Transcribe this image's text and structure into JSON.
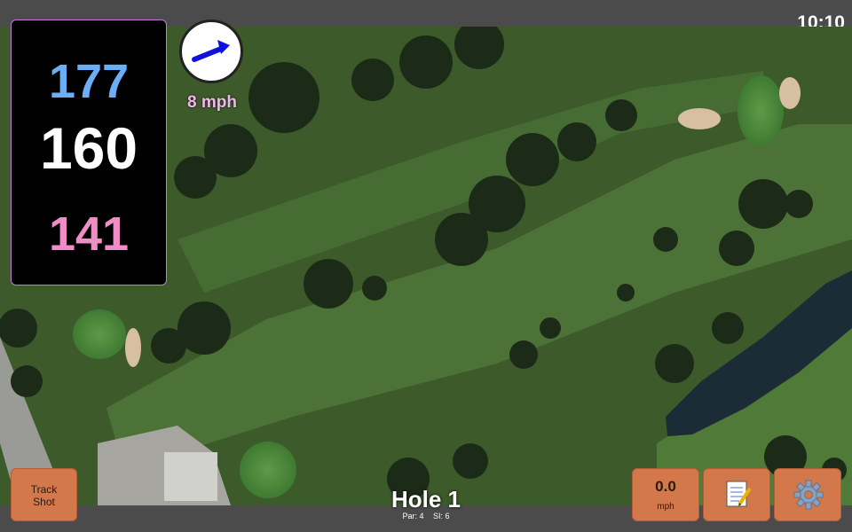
{
  "status": {
    "time": "10:10"
  },
  "distances": {
    "back": "177",
    "middle": "160",
    "front": "141"
  },
  "wind": {
    "speed_label": "8 mph"
  },
  "hole": {
    "title": "Hole 1",
    "par_label": "Par: 4",
    "si_label": "SI: 6"
  },
  "buttons": {
    "track_line1": "Track",
    "track_line2": "Shot",
    "speed_value": "0.0",
    "speed_unit": "mph",
    "notes_icon": "notepad-icon",
    "settings_icon": "gear-icon"
  },
  "colors": {
    "back_distance": "#6aaef5",
    "middle_distance": "#ffffff",
    "front_distance": "#f08cc6",
    "wind_label": "#f4b4f0",
    "button_bg": "#d2784a",
    "wind_arrow": "#1111dd"
  }
}
